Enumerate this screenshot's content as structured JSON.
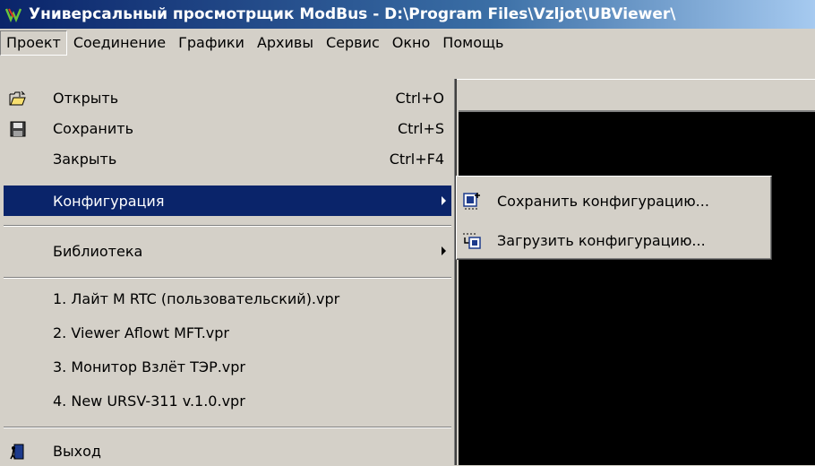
{
  "window": {
    "title": "Универсальный просмотрщик ModBus - D:\\Program Files\\Vzljot\\UBViewer\\"
  },
  "menubar": {
    "items": [
      {
        "label": "Проект"
      },
      {
        "label": "Соединение"
      },
      {
        "label": "Графики"
      },
      {
        "label": "Архивы"
      },
      {
        "label": "Сервис"
      },
      {
        "label": "Окно"
      },
      {
        "label": "Помощь"
      }
    ]
  },
  "project_menu": {
    "open": {
      "label": "Открыть",
      "shortcut": "Ctrl+O",
      "icon": "open-folder-icon"
    },
    "save": {
      "label": "Сохранить",
      "shortcut": "Ctrl+S",
      "icon": "floppy-disk-icon"
    },
    "close": {
      "label": "Закрыть",
      "shortcut": "Ctrl+F4"
    },
    "configuration": {
      "label": "Конфигурация"
    },
    "library": {
      "label": "Библиотека"
    },
    "recent": [
      {
        "label": "1. Лайт М RTC (пользовательский).vpr"
      },
      {
        "label": "2. Viewer Aflowt MFT.vpr"
      },
      {
        "label": "3. Монитор Взлёт ТЭР.vpr"
      },
      {
        "label": "4. New URSV-311 v.1.0.vpr"
      }
    ],
    "exit": {
      "label": "Выход",
      "icon": "exit-icon"
    }
  },
  "config_submenu": {
    "save_config": {
      "label": "Сохранить конфигурацию...",
      "icon": "save-config-icon"
    },
    "load_config": {
      "label": "Загрузить конфигурацию...",
      "icon": "load-config-icon"
    }
  },
  "colors": {
    "highlight": "#0a246a",
    "menu_bg": "#d4d0c8"
  }
}
